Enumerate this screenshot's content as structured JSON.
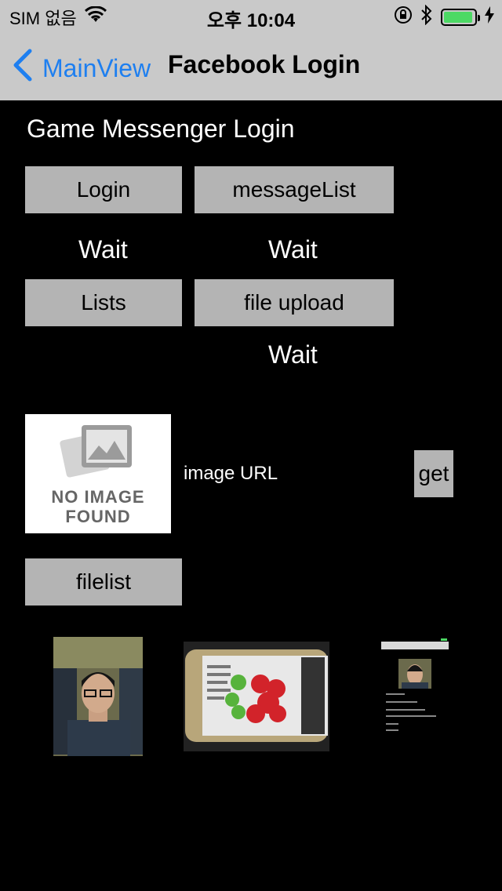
{
  "status_bar": {
    "carrier": "SIM 없음",
    "time": "오후 10:04",
    "battery_level": 0.95
  },
  "nav": {
    "back_label": "MainView",
    "title": "Facebook Login"
  },
  "content": {
    "title": "Game Messenger Login",
    "buttons": {
      "login": "Login",
      "message_list": "messageList",
      "lists": "Lists",
      "file_upload": "file upload",
      "get": "get",
      "filelist": "filelist"
    },
    "statuses": {
      "login_status": "Wait",
      "message_status": "Wait",
      "upload_status": "Wait"
    },
    "image_url_label": "image URL",
    "no_image": {
      "line1": "NO IMAGE",
      "line2": "FOUND"
    }
  },
  "colors": {
    "accent": "#1e7ff0",
    "bar_bg": "#c9c9c9",
    "button_bg": "#b4b4b4",
    "battery": "#4cd964"
  }
}
